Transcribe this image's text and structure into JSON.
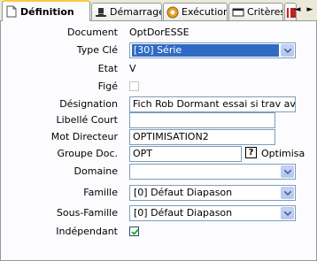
{
  "tabs": [
    {
      "label": "Définition",
      "icon": "document-icon",
      "active": true
    },
    {
      "label": "Démarrage",
      "icon": "top-hat-icon",
      "active": false
    },
    {
      "label": "Exécution",
      "icon": "gear-icon",
      "active": false
    },
    {
      "label": "Critères",
      "icon": "window-icon",
      "active": false
    },
    {
      "label": "",
      "icon": "book-icon",
      "active": false
    }
  ],
  "tab_scroll": {
    "left": "◄",
    "right": "►"
  },
  "form": {
    "document": {
      "label": "Document",
      "value": "OptDorESSE"
    },
    "type_cle": {
      "label": "Type Clé",
      "value": "[30] Série"
    },
    "etat": {
      "label": "Etat",
      "value": "V"
    },
    "fige": {
      "label": "Figé",
      "checked": false
    },
    "designation": {
      "label": "Désignation",
      "value": "Fich Rob Dormant essai si trav avant"
    },
    "libelle_court": {
      "label": "Libellé Court",
      "value": ""
    },
    "mot_directeur": {
      "label": "Mot Directeur",
      "value": "OPTIMISATION2"
    },
    "groupe_doc": {
      "label": "Groupe Doc.",
      "value": "OPT",
      "help": "?",
      "trailing": "Optimisa"
    },
    "domaine": {
      "label": "Domaine",
      "value": ""
    },
    "famille": {
      "label": "Famille",
      "value": "[0] Défaut Diapason"
    },
    "sous_famille": {
      "label": "Sous-Famille",
      "value": "[0] Défaut Diapason"
    },
    "independant": {
      "label": "Indépendant",
      "checked": true
    }
  },
  "colors": {
    "accent_tab": "#ffc83c",
    "selection": "#316ac5",
    "checkmark": "#21a121"
  }
}
